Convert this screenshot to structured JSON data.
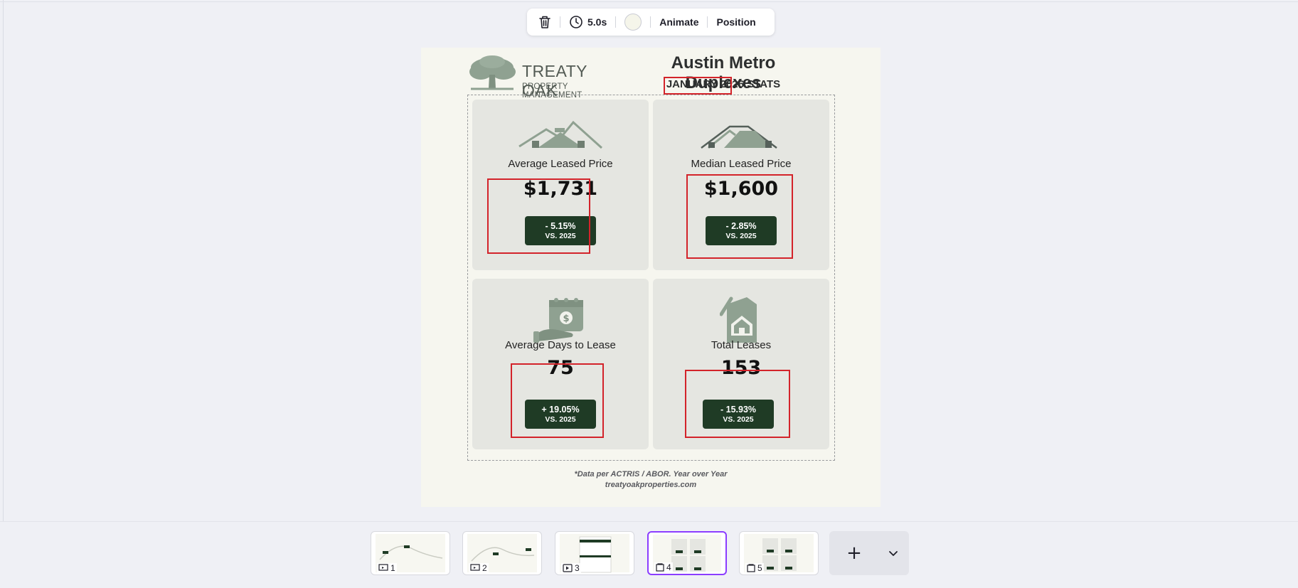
{
  "toolbar": {
    "duration": "5.0s",
    "animate_label": "Animate",
    "position_label": "Position",
    "swatch_color": "#f5f5ea"
  },
  "design": {
    "logo": {
      "name": "TREATY OAK",
      "sub": "PROPERTY MANAGEMENT"
    },
    "title": "Austin Metro Duplexes",
    "subtitle": "JANUARY 2026 STATS",
    "cards": [
      {
        "label": "Average Leased Price",
        "value": "$1,731",
        "change": "- 5.15%",
        "compare": "VS. 2025",
        "icon": "house-icon"
      },
      {
        "label": "Median Leased Price",
        "value": "$1,600",
        "change": "- 2.85%",
        "compare": "VS. 2025",
        "icon": "houses-icon"
      },
      {
        "label": "Average Days to Lease",
        "value": "75",
        "change": "+ 19.05%",
        "compare": "VS. 2025",
        "icon": "calendar-hand-icon"
      },
      {
        "label": "Total Leases",
        "value": "153",
        "change": "- 15.93%",
        "compare": "VS. 2025",
        "icon": "house-document-icon"
      }
    ],
    "footnote": "*Data per ACTRIS / ABOR. Year over Year",
    "website": "treatyoakproperties.com"
  },
  "pages": [
    {
      "num": "1",
      "icon": "presentation-icon",
      "active": false
    },
    {
      "num": "2",
      "icon": "presentation-icon",
      "active": false
    },
    {
      "num": "3",
      "icon": "video-icon",
      "active": false
    },
    {
      "num": "4",
      "icon": "doc-icon",
      "active": true
    },
    {
      "num": "5",
      "icon": "doc-icon",
      "active": false
    }
  ],
  "colors": {
    "accent": "#8b3dff",
    "badge": "#1f3b25",
    "highlight": "#d3232a",
    "icon_green": "#8fa191"
  }
}
